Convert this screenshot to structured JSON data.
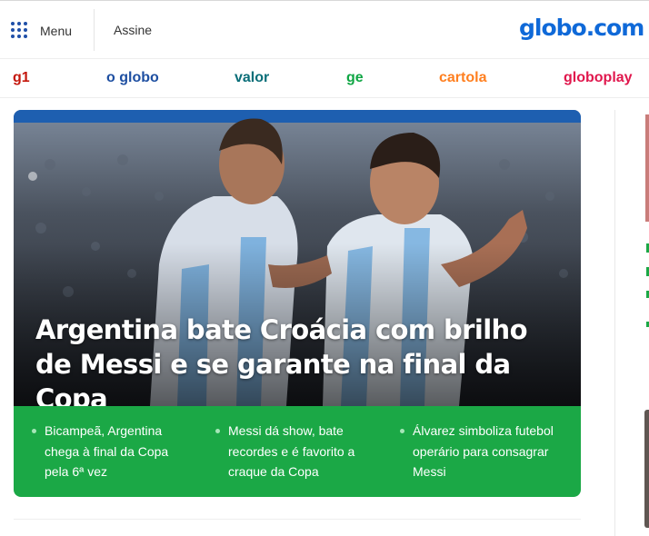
{
  "header": {
    "menu_label": "Menu",
    "subscribe_label": "Assine",
    "logo_text_main": "globo",
    "logo_text_dot": ".",
    "logo_text_tld": "com"
  },
  "brands": [
    {
      "label": "g1",
      "color": "#c4170c"
    },
    {
      "label": "o globo",
      "color": "#1e4fa1"
    },
    {
      "label": "valor",
      "color": "#0a6e78"
    },
    {
      "label": "ge",
      "color": "#0fa644"
    },
    {
      "label": "cartola",
      "color": "#ff7f1f"
    },
    {
      "label": "globoplay",
      "color": "#e0174d"
    }
  ],
  "hero": {
    "title": "Argentina bate Croácia com brilho de Messi e se garante na final da Copa",
    "related": [
      "Bicampeã, Argentina chega à final da Copa pela 6ª vez",
      "Messi dá show, bate recordes e é favorito a craque da Copa",
      "Álvarez simboliza futebol operário para consagrar Messi"
    ],
    "accent_color": "#1ba846"
  }
}
